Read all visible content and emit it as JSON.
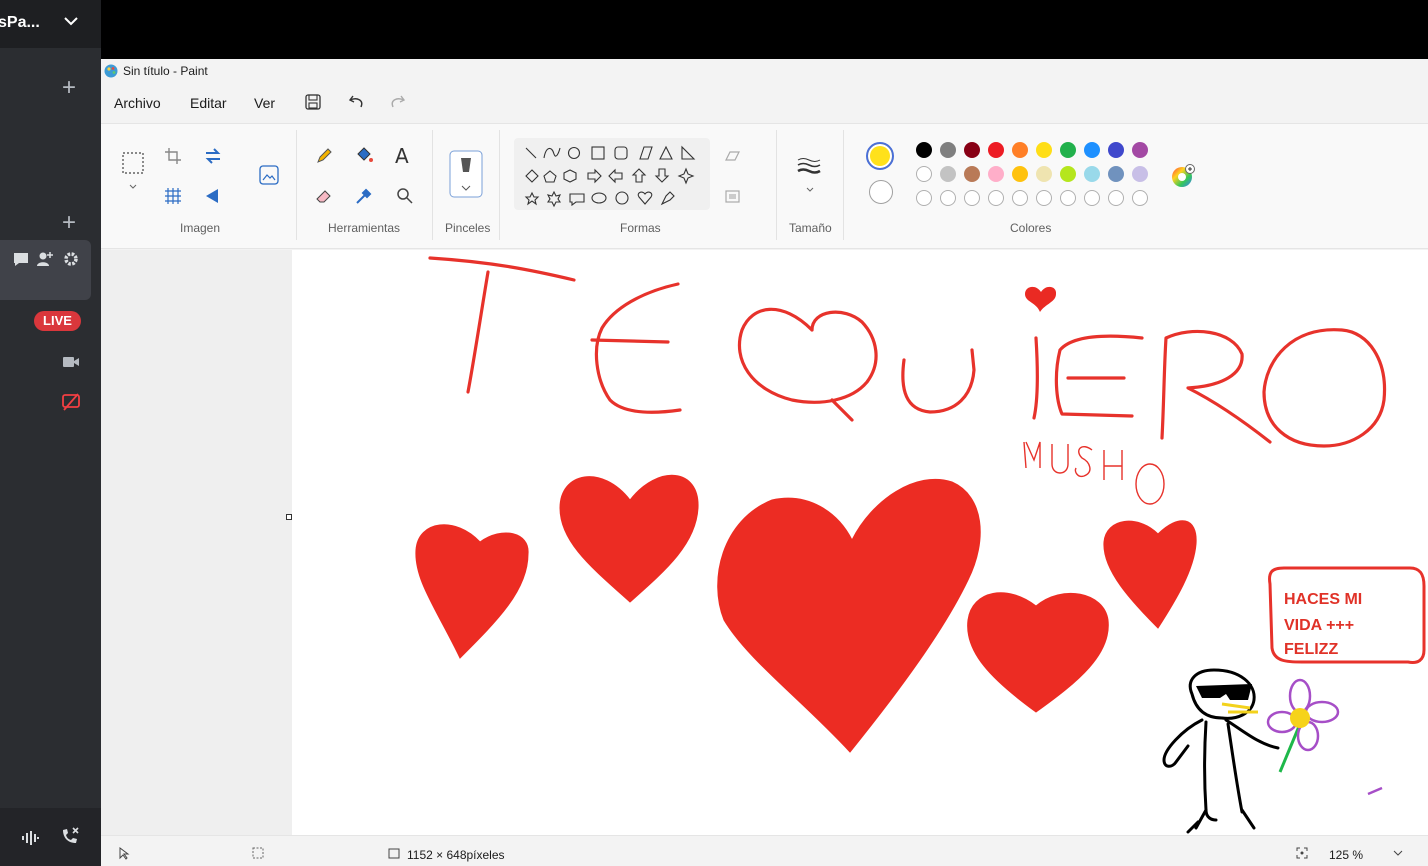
{
  "discord": {
    "server_name": "sPa...",
    "live_badge": "LIVE"
  },
  "paint": {
    "window_title": "Sin título - Paint",
    "menu": {
      "file": "Archivo",
      "edit": "Editar",
      "view": "Ver"
    },
    "ribbon_groups": {
      "image": "Imagen",
      "tools": "Herramientas",
      "brushes": "Pinceles",
      "shapes": "Formas",
      "size": "Tamaño",
      "colors": "Colores"
    },
    "tool_text_glyph": "A",
    "primary_color": "#ffe11b",
    "secondary_color": "#ffffff",
    "palette_row1": [
      "#000000",
      "#7f7f7f",
      "#880015",
      "#ed1c24",
      "#ff7f27",
      "#ffde17",
      "#22b14c",
      "#1e90ff",
      "#3f48cc",
      "#a349a4"
    ],
    "palette_row2": [
      "#ffffff",
      "#c3c3c3",
      "#b97a57",
      "#ffaec9",
      "#ffc20e",
      "#efe4b0",
      "#b5e61d",
      "#99d9ea",
      "#7092be",
      "#c8bfe7"
    ],
    "status": {
      "dimensions": "1152 × 648píxeles",
      "zoom": "125 %"
    }
  },
  "drawing": {
    "words_big": "TE QUIERO",
    "word_small": "MUSHO",
    "speech_lines": [
      "HACES MI",
      "VIDA +++",
      "FELIZZ"
    ]
  }
}
